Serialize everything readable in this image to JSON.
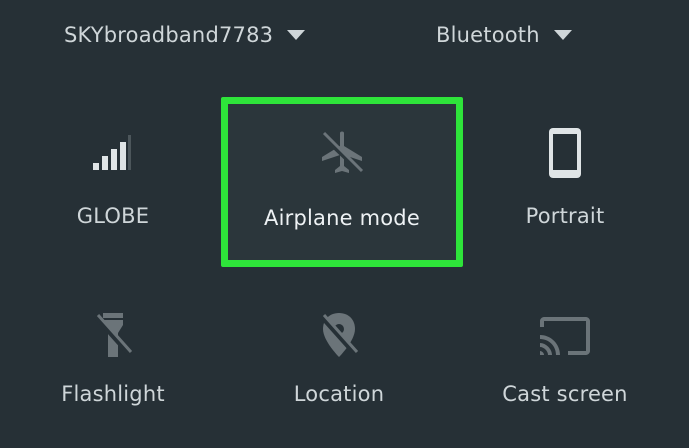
{
  "top_bar": {
    "wifi_network": "SKYbroadband7783",
    "bluetooth": "Bluetooth"
  },
  "tiles": [
    {
      "label": "GLOBE",
      "icon": "cell-signal-icon"
    },
    {
      "label": "Airplane mode",
      "icon": "airplane-icon"
    },
    {
      "label": "Portrait",
      "icon": "phone-portrait-icon"
    },
    {
      "label": "Flashlight",
      "icon": "flashlight-off-icon"
    },
    {
      "label": "Location",
      "icon": "location-off-icon"
    },
    {
      "label": "Cast screen",
      "icon": "cast-icon"
    }
  ],
  "colors": {
    "background": "#263036",
    "highlight": "#2ee43a",
    "icon_active": "#dfe4e6",
    "icon_inactive": "#6b7479"
  }
}
